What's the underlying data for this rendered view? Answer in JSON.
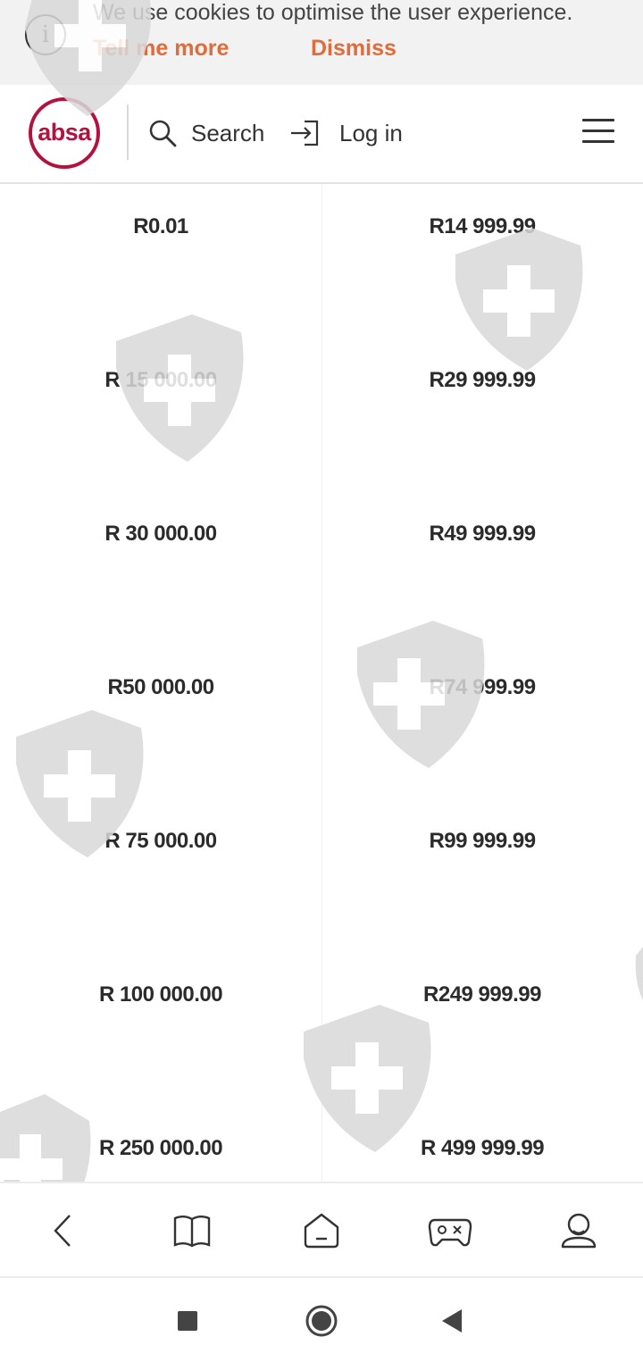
{
  "cookie_banner": {
    "message": "We use cookies to optimise the user experience.",
    "tell_more": "Tell me more",
    "dismiss": "Dismiss",
    "icon": "info-icon"
  },
  "header": {
    "logo_text": "absa",
    "search_label": "Search",
    "login_label": "Log in",
    "icons": [
      "search-icon",
      "login-icon",
      "hamburger-menu-icon"
    ]
  },
  "colors": {
    "brand": "#b4123e",
    "accent": "#e06c3b"
  },
  "price_ranges": [
    {
      "from": "R0.01",
      "to": "R14 999.99"
    },
    {
      "from": "R 15 000.00",
      "to": "R29 999.99"
    },
    {
      "from": "R 30 000.00",
      "to": "R49 999.99"
    },
    {
      "from": "R50 000.00",
      "to": "R74 999.99"
    },
    {
      "from": "R 75 000.00",
      "to": "R99 999.99"
    },
    {
      "from": "R 100 000.00",
      "to": "R249 999.99"
    },
    {
      "from": "R 250 000.00",
      "to": "R 499 999.99"
    }
  ],
  "app_nav": {
    "icons": [
      "back-chevron-icon",
      "book-icon",
      "home-icon",
      "gamepad-icon",
      "profile-icon"
    ]
  },
  "system_nav": {
    "icons": [
      "recents-square-icon",
      "home-circle-icon",
      "back-triangle-icon"
    ]
  }
}
